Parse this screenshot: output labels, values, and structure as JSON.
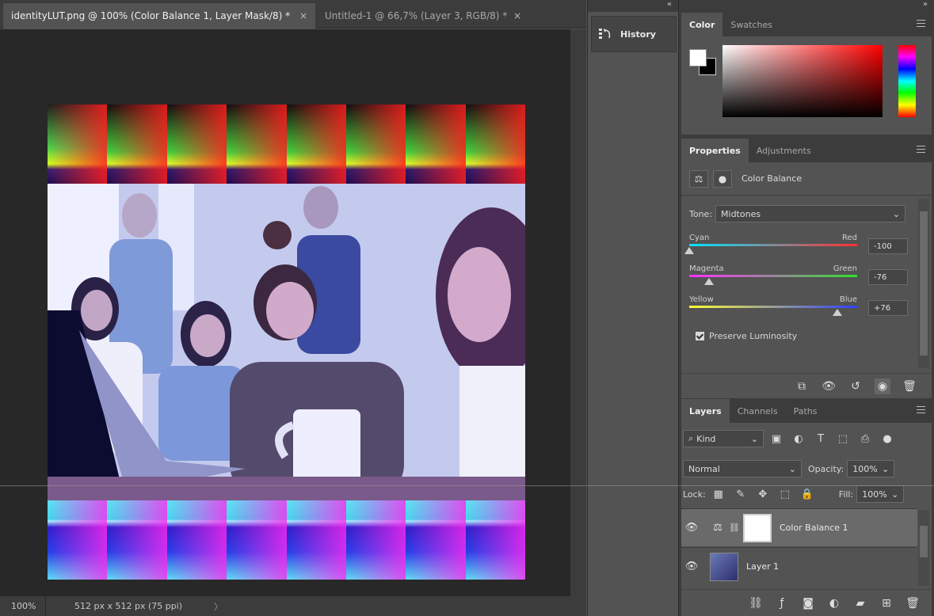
{
  "document": {
    "tabs": [
      {
        "label": "identityLUT.png @ 100% (Color Balance 1, Layer Mask/8) *",
        "close": "×"
      },
      {
        "label": "Untitled-1 @ 66,7% (Layer 3, RGB/8) *",
        "close": "×"
      }
    ]
  },
  "status": {
    "zoom": "100%",
    "dimensions": "512 px x 512 px (75 ppi)",
    "arrow": "〉"
  },
  "panels": {
    "collapse_left": "«",
    "collapse_right": "»",
    "history": {
      "label": "History"
    },
    "color": {
      "tabs": [
        "Color",
        "Swatches"
      ]
    },
    "properties": {
      "tabs": [
        "Properties",
        "Adjustments"
      ],
      "title": "Color Balance",
      "tone_label": "Tone:",
      "tone_value": "Midtones",
      "sliders": [
        {
          "left": "Cyan",
          "right": "Red",
          "value": "-100",
          "position": 0.0
        },
        {
          "left": "Magenta",
          "right": "Green",
          "value": "-76",
          "position": 0.12
        },
        {
          "left": "Yellow",
          "right": "Blue",
          "value": "+76",
          "position": 0.88
        }
      ],
      "preserve_luminosity": "Preserve Luminosity"
    },
    "layers": {
      "tabs": [
        "Layers",
        "Channels",
        "Paths"
      ],
      "kind": "Kind",
      "blend_mode": "Normal",
      "opacity_label": "Opacity:",
      "opacity_value": "100%",
      "lock_label": "Lock:",
      "fill_label": "Fill:",
      "fill_value": "100%",
      "items": [
        {
          "name": "Color Balance 1"
        },
        {
          "name": "Layer 1"
        }
      ]
    }
  },
  "colors": {
    "accent_selected_layer": "#6a6a6a",
    "panel_bg": "#535353",
    "tab_bg": "#3c3c3c"
  }
}
